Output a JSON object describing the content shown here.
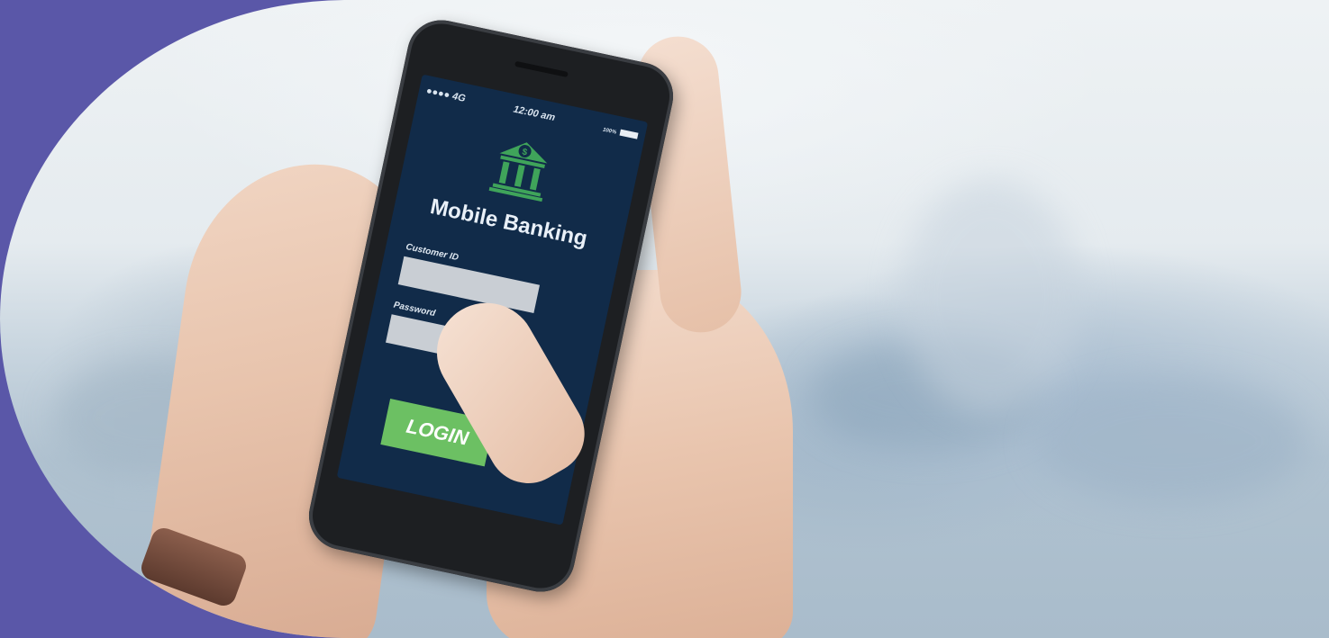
{
  "background_color": "#5a57a8",
  "phone_screen": {
    "status": {
      "signal": "●●●● 4G",
      "time": "12:00 am",
      "battery": "100%"
    },
    "app_title": "Mobile Banking",
    "bank_icon": "bank-building-icon",
    "customer_id_label": "Customer ID",
    "customer_id_value": "",
    "password_label": "Password",
    "password_value": "",
    "login_label": "LOGIN",
    "screen_color": "#112b49",
    "button_color": "#6cc063",
    "icon_color": "#3fa45a"
  }
}
